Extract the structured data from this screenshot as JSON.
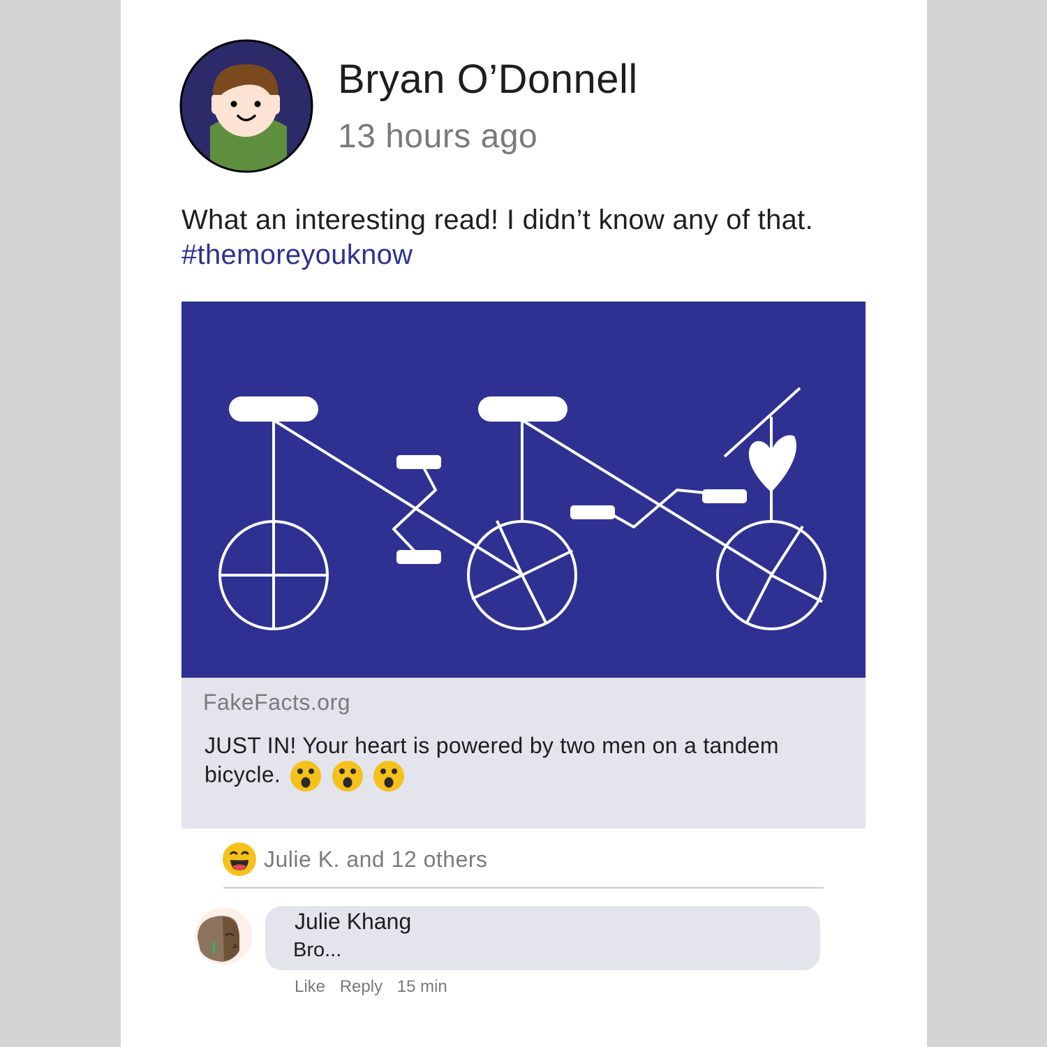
{
  "post": {
    "author": "Bryan O’Donnell",
    "timestamp": "13 hours ago",
    "text": "What an interesting read! I didn’t know any of that.",
    "hashtag": "#themoreyouknow",
    "avatar_icon": "smiling-person-avatar"
  },
  "link_preview": {
    "image_icon": "tandem-bicycle-heart-illustration",
    "site": "FakeFacts.org",
    "headline": "JUST IN! Your heart is powered by two men on a tandem bicycle.",
    "headline_emojis": [
      "astonished-face-icon",
      "astonished-face-icon",
      "astonished-face-icon"
    ]
  },
  "reactions": {
    "icon": "grinning-face-icon",
    "text": "Julie K. and 12 others"
  },
  "comment": {
    "author": "Julie Khang",
    "text": "Bro...",
    "like_label": "Like",
    "reply_label": "Reply",
    "time": "15 min"
  },
  "colors": {
    "page_bg": "#d4d4d4",
    "card_bg": "#ffffff",
    "accent_blue": "#2e3192",
    "preview_bg": "#e3e4ec",
    "muted_text": "#7a7a7a",
    "emoji_yellow": "#f5c11a"
  }
}
